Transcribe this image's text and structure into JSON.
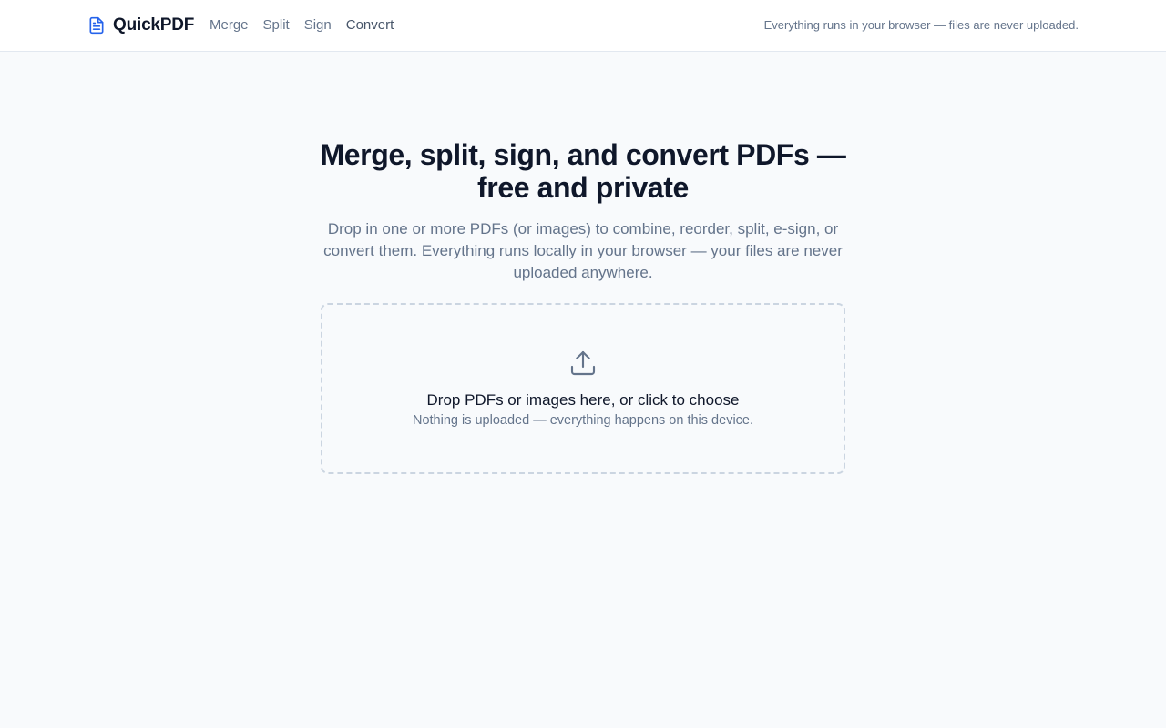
{
  "brand": {
    "name": "QuickPDF",
    "icon": "document-icon",
    "accent_color": "#2563eb"
  },
  "nav": {
    "items": [
      {
        "label": "Merge"
      },
      {
        "label": "Split"
      },
      {
        "label": "Sign"
      },
      {
        "label": "Convert"
      }
    ]
  },
  "header": {
    "tagline": "Everything runs in your browser — files are never uploaded."
  },
  "hero": {
    "title": "Merge, split, sign, and convert PDFs — free and private",
    "description": "Drop in one or more PDFs (or images) to combine, reorder, split, e-sign, or convert them. Everything runs locally in your browser — your files are never uploaded anywhere."
  },
  "dropzone": {
    "icon": "upload-icon",
    "title": "Drop PDFs or images here, or click to choose",
    "subtitle": "Nothing is uploaded — everything happens on this device."
  }
}
